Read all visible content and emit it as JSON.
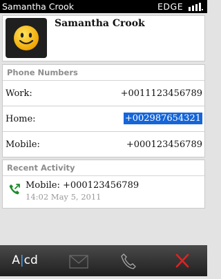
{
  "statusbar": {
    "owner": "Samantha Crook",
    "network": "EDGE"
  },
  "contact": {
    "name": "Samantha Crook",
    "avatar_icon": "smiley-face-icon"
  },
  "phones": {
    "header": "Phone Numbers",
    "items": [
      {
        "label": "Work:",
        "value": "+0011123456789"
      },
      {
        "label": "Home:",
        "value": "+002987654321",
        "selected": true
      },
      {
        "label": "Mobile:",
        "value": "+000123456789"
      }
    ]
  },
  "activity": {
    "header": "Recent Activity",
    "items": [
      {
        "icon": "outgoing-call-icon",
        "title": "Mobile: +000123456789",
        "time": "14:02 May 5, 2011"
      }
    ]
  },
  "toolbar": {
    "text_left": "A",
    "text_right": "cd",
    "buttons": [
      "text-input-icon",
      "email-icon",
      "phone-icon",
      "close-icon"
    ]
  },
  "colors": {
    "selection": "#1565d8",
    "call_icon": "#1e8b2d",
    "close": "#e42020"
  }
}
